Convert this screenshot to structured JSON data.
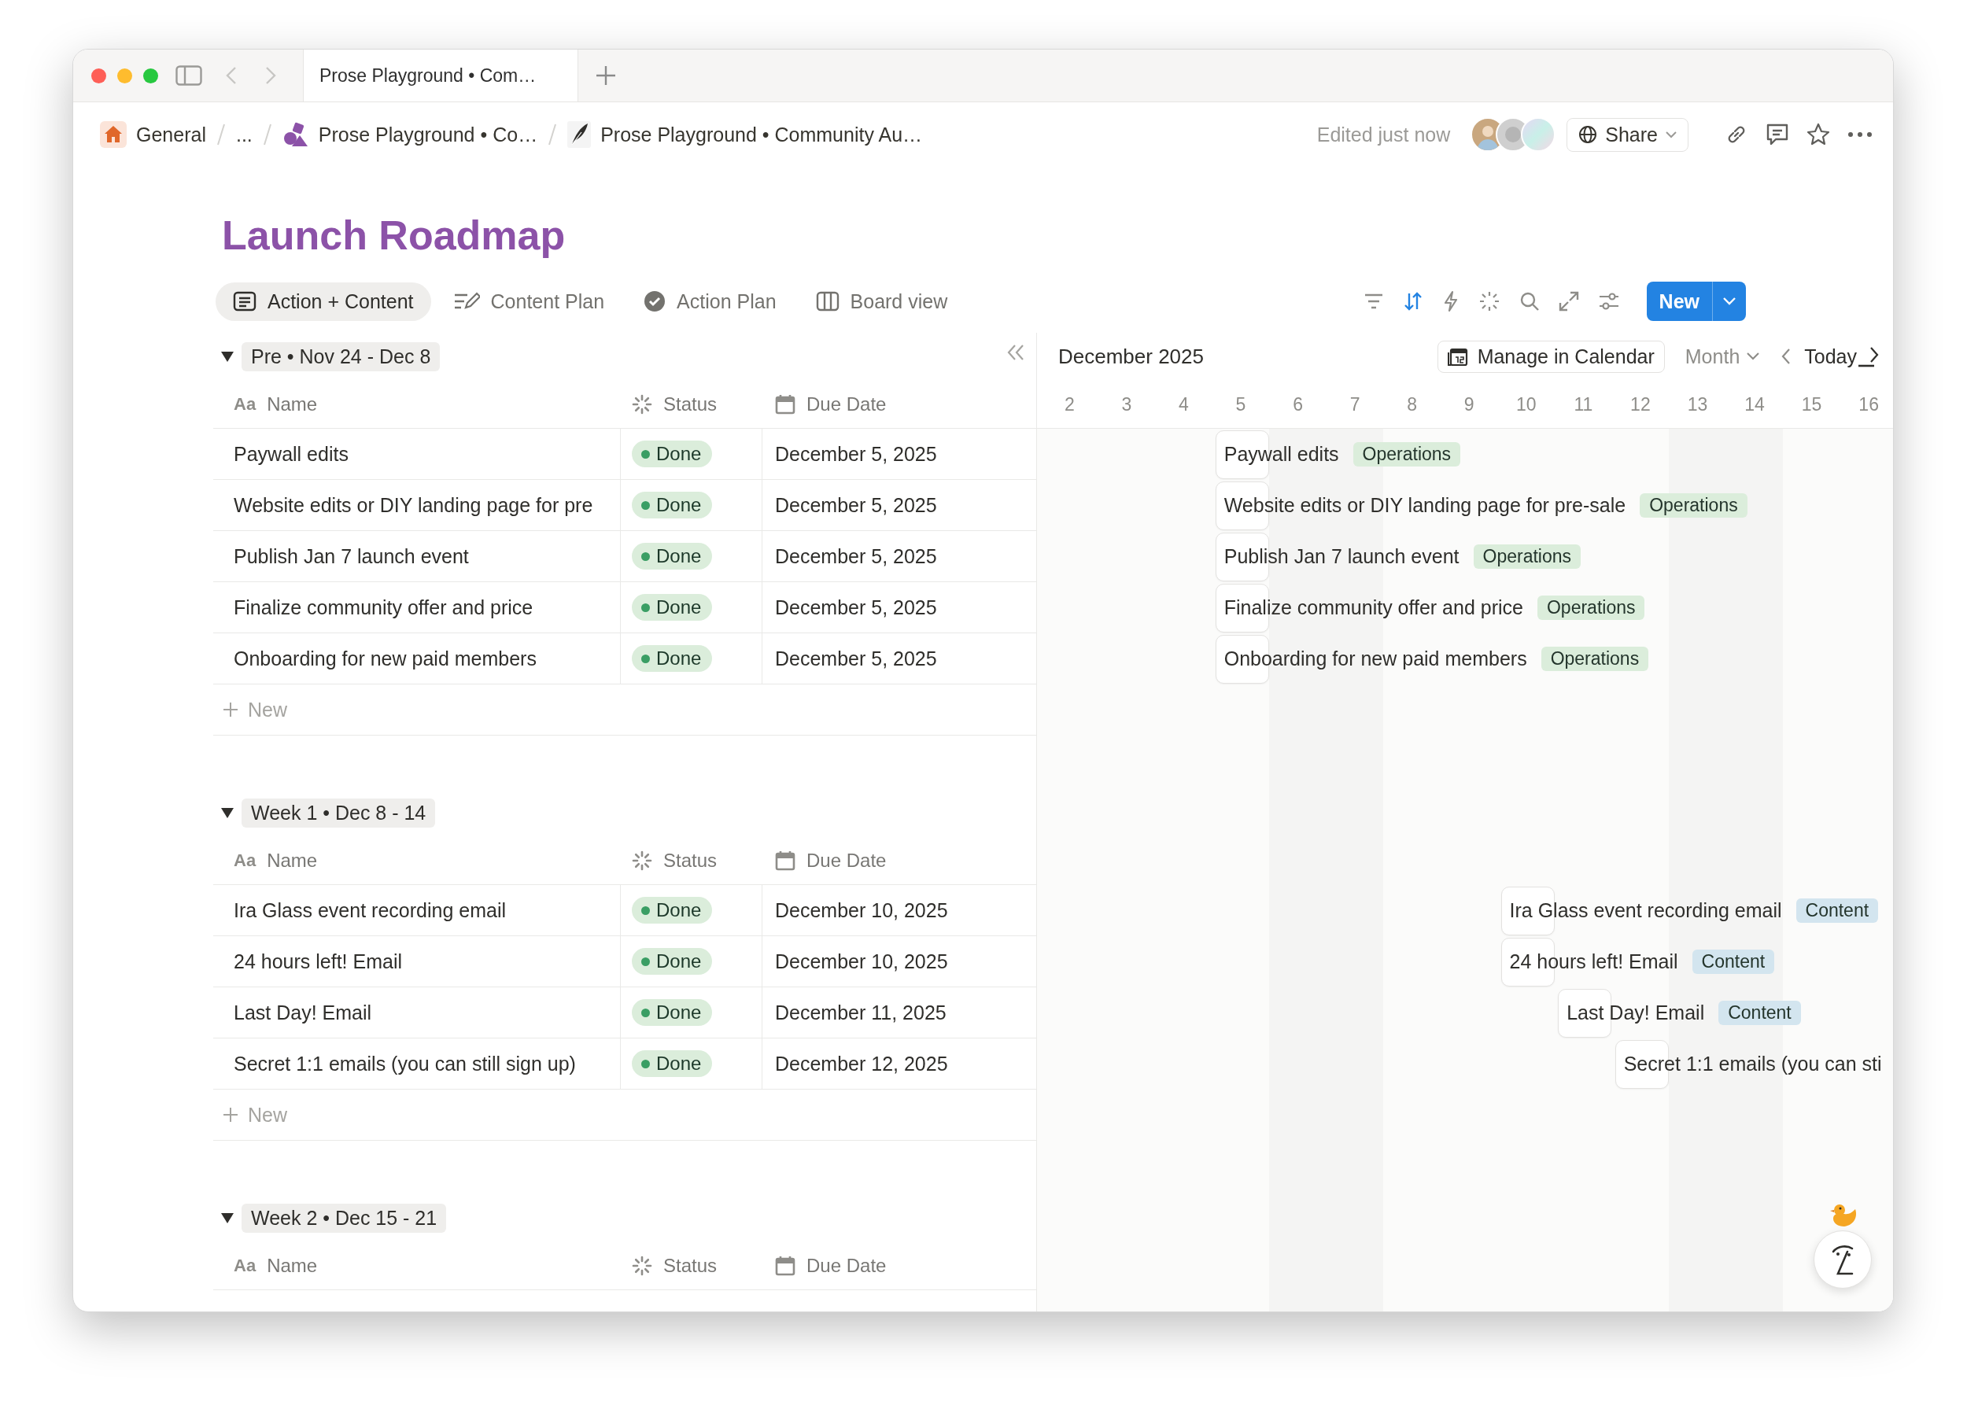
{
  "browser_tab": {
    "title": "Prose Playground • Com…"
  },
  "breadcrumbs": [
    {
      "label": "General",
      "kind": "home"
    },
    {
      "label": "...",
      "kind": "plain"
    },
    {
      "label": "Prose Playground • Co…",
      "kind": "shapes"
    },
    {
      "label": "Prose Playground • Community Au…",
      "kind": "quill"
    }
  ],
  "edited": "Edited just now",
  "share": "Share",
  "title": "Launch Roadmap",
  "views": [
    {
      "label": "Action + Content",
      "kind": "list",
      "selected": true
    },
    {
      "label": "Content Plan",
      "kind": "plan",
      "selected": false
    },
    {
      "label": "Action Plan",
      "kind": "check",
      "selected": false
    },
    {
      "label": "Board view",
      "kind": "board",
      "selected": false
    }
  ],
  "new_button": "New",
  "calendar": {
    "month": "December 2025",
    "manage": "Manage in Calendar",
    "range": "Month",
    "today": "Today",
    "days": [
      "2",
      "3",
      "4",
      "5",
      "6",
      "7",
      "8",
      "9",
      "10",
      "11",
      "12",
      "13",
      "14",
      "15",
      "16"
    ]
  },
  "groups": [
    {
      "label": "Pre • Nov 24 - Dec 8",
      "expanded": true,
      "columns": [
        {
          "label": "Name",
          "kind": "title",
          "glyph": "Aa"
        },
        {
          "label": "Status",
          "kind": "status"
        },
        {
          "label": "Due Date",
          "kind": "date"
        }
      ],
      "new_label": "New",
      "rows": [
        {
          "name": "Paywall edits",
          "status": "Done",
          "due_date": "December 5, 2025",
          "timeline": {
            "label": "Paywall edits",
            "tag": {
              "label": "Operations",
              "color": "#dbeddb"
            }
          }
        },
        {
          "name": "Website edits or DIY landing page for pre",
          "status": "Done",
          "due_date": "December 5, 2025",
          "timeline": {
            "label": "Website edits or DIY landing page for pre-sale",
            "tag": {
              "label": "Operations",
              "color": "#dbeddb"
            }
          }
        },
        {
          "name": "Publish Jan 7 launch event",
          "status": "Done",
          "due_date": "December 5, 2025",
          "timeline": {
            "label": "Publish Jan 7 launch event",
            "tag": {
              "label": "Operations",
              "color": "#dbeddb"
            }
          }
        },
        {
          "name": "Finalize community offer and price",
          "status": "Done",
          "due_date": "December 5, 2025",
          "timeline": {
            "label": "Finalize community offer and price",
            "tag": {
              "label": "Operations",
              "color": "#dbeddb"
            }
          }
        },
        {
          "name": "Onboarding for new paid members",
          "status": "Done",
          "due_date": "December 5, 2025",
          "timeline": {
            "label": "Onboarding for new paid members",
            "tag": {
              "label": "Operations",
              "color": "#dbeddb"
            }
          }
        }
      ]
    },
    {
      "label": "Week 1 • Dec 8 - 14",
      "expanded": true,
      "columns": [
        {
          "label": "Name",
          "kind": "title",
          "glyph": "Aa"
        },
        {
          "label": "Status",
          "kind": "status"
        },
        {
          "label": "Due Date",
          "kind": "date"
        }
      ],
      "new_label": "New",
      "rows": [
        {
          "name": "Ira Glass event recording email",
          "status": "Done",
          "due_date": "December 10, 2025",
          "timeline": {
            "label": "Ira Glass event recording email",
            "tag": {
              "label": "Content",
              "color": "#d3e5ef"
            }
          }
        },
        {
          "name": "24 hours left! Email",
          "status": "Done",
          "due_date": "December 10, 2025",
          "timeline": {
            "label": "24 hours left! Email",
            "tag": {
              "label": "Content",
              "color": "#d3e5ef"
            }
          }
        },
        {
          "name": "Last Day! Email",
          "status": "Done",
          "due_date": "December 11, 2025",
          "timeline": {
            "label": "Last Day! Email",
            "tag": {
              "label": "Content",
              "color": "#d3e5ef"
            }
          }
        },
        {
          "name": "Secret 1:1 emails (you can still sign up)",
          "status": "Done",
          "due_date": "December 12, 2025",
          "timeline": {
            "label": "Secret 1:1 emails (you can sti"
          }
        }
      ]
    },
    {
      "label": "Week 2 • Dec 15 - 21",
      "expanded": true,
      "columns": [
        {
          "label": "Name",
          "kind": "title",
          "glyph": "Aa"
        },
        {
          "label": "Status",
          "kind": "status"
        },
        {
          "label": "Due Date",
          "kind": "date"
        }
      ]
    }
  ]
}
